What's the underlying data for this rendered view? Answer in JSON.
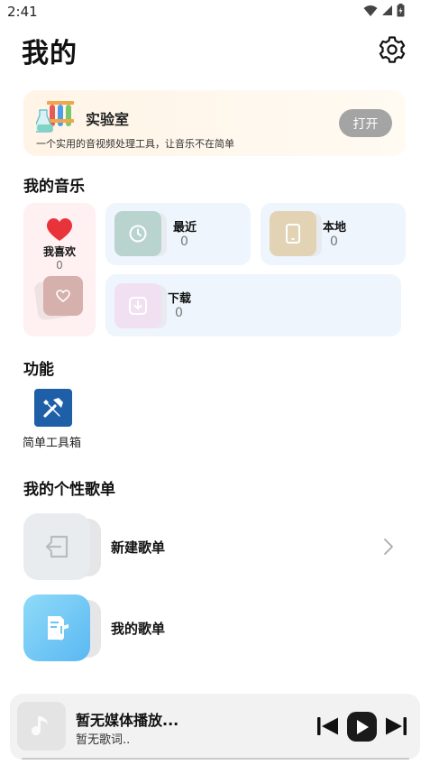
{
  "status_bar": {
    "time": "2:41"
  },
  "header": {
    "title": "我的"
  },
  "lab": {
    "title": "实验室",
    "description": "一个实用的音视频处理工具，让音乐不在简单",
    "open_label": "打开"
  },
  "my_music": {
    "section_title": "我的音乐",
    "favorites": {
      "label": "我喜欢",
      "count": "0"
    },
    "recent": {
      "label": "最近",
      "count": "0"
    },
    "local": {
      "label": "本地",
      "count": "0"
    },
    "download": {
      "label": "下载",
      "count": "0"
    }
  },
  "functions": {
    "section_title": "功能",
    "items": [
      {
        "label": "简单工具箱",
        "icon": "toolbox-icon"
      }
    ]
  },
  "playlists": {
    "section_title": "我的个性歌单",
    "items": [
      {
        "label": "新建歌单",
        "icon": "import-icon"
      },
      {
        "label": "我的歌单",
        "icon": "music-file-icon"
      }
    ]
  },
  "player": {
    "title": "暂无媒体播放...",
    "lyric": "暂无歌词.."
  },
  "colors": {
    "lab_bg": "#fff4e6",
    "fav_bg": "#fff0f1",
    "card_bg": "#eef5fd",
    "recent_tile": "#b9d3cf",
    "local_tile": "#e3d3b5",
    "download_tile": "#f1e0f2",
    "toolbox": "#1f5fa8",
    "heart": "#e8333a"
  }
}
